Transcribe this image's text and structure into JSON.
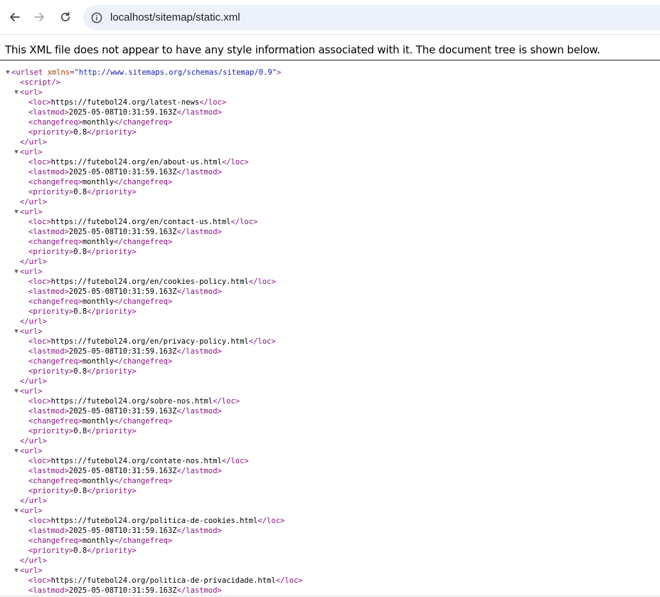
{
  "browser": {
    "url": "localhost/sitemap/static.xml",
    "back_icon": "arrow-left-icon",
    "forward_icon": "arrow-right-icon",
    "reload_icon": "reload-icon",
    "site_info_icon": "info-icon"
  },
  "notice": "This XML file does not appear to have any style information associated with it. The document tree is shown below.",
  "xml": {
    "root_open": "<urlset",
    "root_attr_name": "xmlns",
    "root_attr_value": "\"http://www.sitemaps.org/schemas/sitemap/0.9\"",
    "root_open_end": ">",
    "script_tag": "<script/>",
    "lastmod": "2025-05-08T10:31:59.163Z",
    "changefreq": "monthly",
    "priority": "0.8",
    "urls": [
      "https://futebol24.org/latest-news",
      "https://futebol24.org/en/about-us.html",
      "https://futebol24.org/en/contact-us.html",
      "https://futebol24.org/en/cookies-policy.html",
      "https://futebol24.org/en/privacy-policy.html",
      "https://futebol24.org/sobre-nos.html",
      "https://futebol24.org/contate-nos.html",
      "https://futebol24.org/politica-de-cookies.html",
      "https://futebol24.org/politica-de-privacidade.html"
    ]
  },
  "colors": {
    "tag": "#881280",
    "attr_name": "#994500",
    "attr_value": "#1a1aa6",
    "omnibox_bg": "#edf1f9"
  }
}
